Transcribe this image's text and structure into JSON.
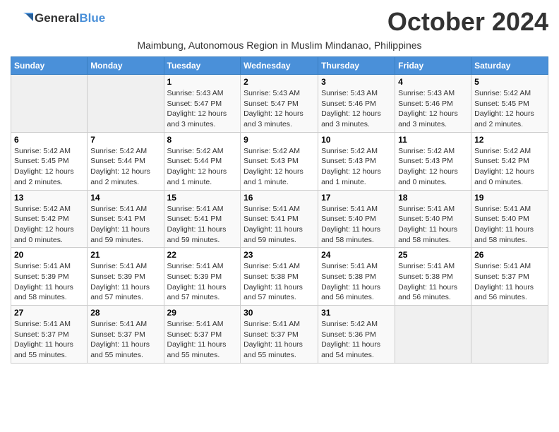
{
  "logo": {
    "general": "General",
    "blue": "Blue"
  },
  "title": "October 2024",
  "subtitle": "Maimbung, Autonomous Region in Muslim Mindanao, Philippines",
  "days_of_week": [
    "Sunday",
    "Monday",
    "Tuesday",
    "Wednesday",
    "Thursday",
    "Friday",
    "Saturday"
  ],
  "weeks": [
    [
      {
        "day": "",
        "content": ""
      },
      {
        "day": "",
        "content": ""
      },
      {
        "day": "1",
        "content": "Sunrise: 5:43 AM\nSunset: 5:47 PM\nDaylight: 12 hours and 3 minutes."
      },
      {
        "day": "2",
        "content": "Sunrise: 5:43 AM\nSunset: 5:47 PM\nDaylight: 12 hours and 3 minutes."
      },
      {
        "day": "3",
        "content": "Sunrise: 5:43 AM\nSunset: 5:46 PM\nDaylight: 12 hours and 3 minutes."
      },
      {
        "day": "4",
        "content": "Sunrise: 5:43 AM\nSunset: 5:46 PM\nDaylight: 12 hours and 3 minutes."
      },
      {
        "day": "5",
        "content": "Sunrise: 5:42 AM\nSunset: 5:45 PM\nDaylight: 12 hours and 2 minutes."
      }
    ],
    [
      {
        "day": "6",
        "content": "Sunrise: 5:42 AM\nSunset: 5:45 PM\nDaylight: 12 hours and 2 minutes."
      },
      {
        "day": "7",
        "content": "Sunrise: 5:42 AM\nSunset: 5:44 PM\nDaylight: 12 hours and 2 minutes."
      },
      {
        "day": "8",
        "content": "Sunrise: 5:42 AM\nSunset: 5:44 PM\nDaylight: 12 hours and 1 minute."
      },
      {
        "day": "9",
        "content": "Sunrise: 5:42 AM\nSunset: 5:43 PM\nDaylight: 12 hours and 1 minute."
      },
      {
        "day": "10",
        "content": "Sunrise: 5:42 AM\nSunset: 5:43 PM\nDaylight: 12 hours and 1 minute."
      },
      {
        "day": "11",
        "content": "Sunrise: 5:42 AM\nSunset: 5:43 PM\nDaylight: 12 hours and 0 minutes."
      },
      {
        "day": "12",
        "content": "Sunrise: 5:42 AM\nSunset: 5:42 PM\nDaylight: 12 hours and 0 minutes."
      }
    ],
    [
      {
        "day": "13",
        "content": "Sunrise: 5:42 AM\nSunset: 5:42 PM\nDaylight: 12 hours and 0 minutes."
      },
      {
        "day": "14",
        "content": "Sunrise: 5:41 AM\nSunset: 5:41 PM\nDaylight: 11 hours and 59 minutes."
      },
      {
        "day": "15",
        "content": "Sunrise: 5:41 AM\nSunset: 5:41 PM\nDaylight: 11 hours and 59 minutes."
      },
      {
        "day": "16",
        "content": "Sunrise: 5:41 AM\nSunset: 5:41 PM\nDaylight: 11 hours and 59 minutes."
      },
      {
        "day": "17",
        "content": "Sunrise: 5:41 AM\nSunset: 5:40 PM\nDaylight: 11 hours and 58 minutes."
      },
      {
        "day": "18",
        "content": "Sunrise: 5:41 AM\nSunset: 5:40 PM\nDaylight: 11 hours and 58 minutes."
      },
      {
        "day": "19",
        "content": "Sunrise: 5:41 AM\nSunset: 5:40 PM\nDaylight: 11 hours and 58 minutes."
      }
    ],
    [
      {
        "day": "20",
        "content": "Sunrise: 5:41 AM\nSunset: 5:39 PM\nDaylight: 11 hours and 58 minutes."
      },
      {
        "day": "21",
        "content": "Sunrise: 5:41 AM\nSunset: 5:39 PM\nDaylight: 11 hours and 57 minutes."
      },
      {
        "day": "22",
        "content": "Sunrise: 5:41 AM\nSunset: 5:39 PM\nDaylight: 11 hours and 57 minutes."
      },
      {
        "day": "23",
        "content": "Sunrise: 5:41 AM\nSunset: 5:38 PM\nDaylight: 11 hours and 57 minutes."
      },
      {
        "day": "24",
        "content": "Sunrise: 5:41 AM\nSunset: 5:38 PM\nDaylight: 11 hours and 56 minutes."
      },
      {
        "day": "25",
        "content": "Sunrise: 5:41 AM\nSunset: 5:38 PM\nDaylight: 11 hours and 56 minutes."
      },
      {
        "day": "26",
        "content": "Sunrise: 5:41 AM\nSunset: 5:37 PM\nDaylight: 11 hours and 56 minutes."
      }
    ],
    [
      {
        "day": "27",
        "content": "Sunrise: 5:41 AM\nSunset: 5:37 PM\nDaylight: 11 hours and 55 minutes."
      },
      {
        "day": "28",
        "content": "Sunrise: 5:41 AM\nSunset: 5:37 PM\nDaylight: 11 hours and 55 minutes."
      },
      {
        "day": "29",
        "content": "Sunrise: 5:41 AM\nSunset: 5:37 PM\nDaylight: 11 hours and 55 minutes."
      },
      {
        "day": "30",
        "content": "Sunrise: 5:41 AM\nSunset: 5:37 PM\nDaylight: 11 hours and 55 minutes."
      },
      {
        "day": "31",
        "content": "Sunrise: 5:42 AM\nSunset: 5:36 PM\nDaylight: 11 hours and 54 minutes."
      },
      {
        "day": "",
        "content": ""
      },
      {
        "day": "",
        "content": ""
      }
    ]
  ]
}
